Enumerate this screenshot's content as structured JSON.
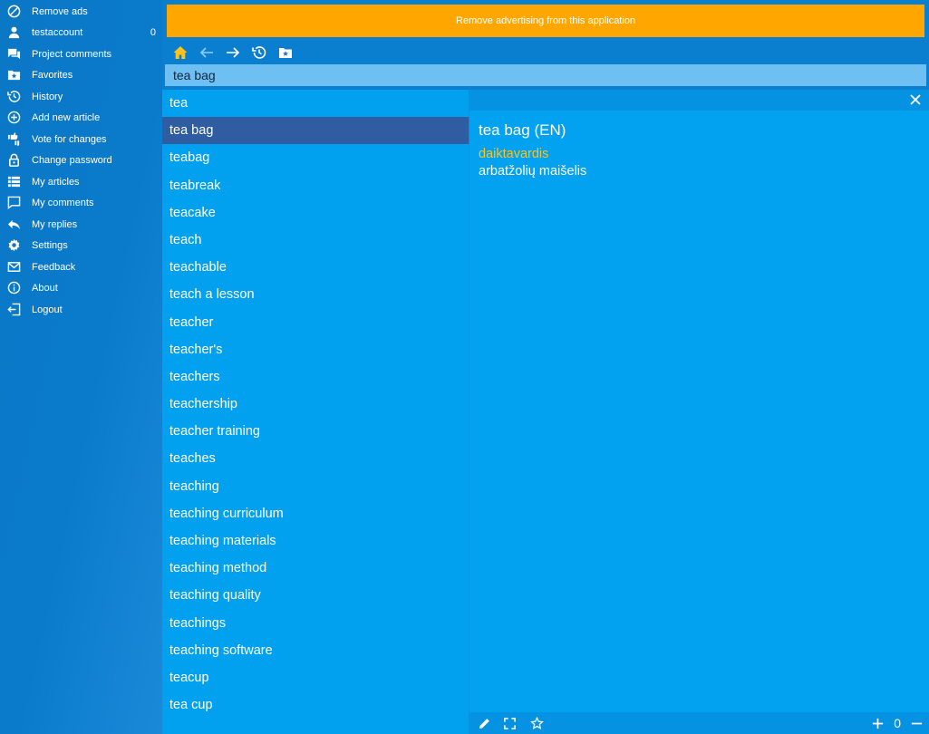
{
  "sidebar": {
    "items": [
      {
        "label": "Remove ads",
        "icon": "block-icon"
      },
      {
        "label": "testaccount",
        "icon": "user-icon",
        "count": "0"
      },
      {
        "label": "Project comments",
        "icon": "forum-icon"
      },
      {
        "label": "Favorites",
        "icon": "folder-star-icon"
      },
      {
        "label": "History",
        "icon": "history-icon"
      },
      {
        "label": "Add new article",
        "icon": "add-circle-icon"
      },
      {
        "label": "Vote for changes",
        "icon": "thumbs-icon"
      },
      {
        "label": "Change password",
        "icon": "lock-icon"
      },
      {
        "label": "My articles",
        "icon": "list-icon"
      },
      {
        "label": "My comments",
        "icon": "comment-icon"
      },
      {
        "label": "My replies",
        "icon": "reply-icon"
      },
      {
        "label": "Settings",
        "icon": "gear-icon"
      },
      {
        "label": "Feedback",
        "icon": "mail-icon"
      },
      {
        "label": "About",
        "icon": "info-icon"
      },
      {
        "label": "Logout",
        "icon": "logout-icon"
      }
    ]
  },
  "ad_banner": {
    "text": "Remove advertising from this application"
  },
  "search": {
    "value": "tea bag"
  },
  "wordlist": {
    "selected_index": 1,
    "words": [
      "tea",
      "tea bag",
      "teabag",
      "teabreak",
      "teacake",
      "teach",
      "teachable",
      "teach a lesson",
      "teacher",
      "teacher's",
      "teachers",
      "teachership",
      "teacher training",
      "teaches",
      "teaching",
      "teaching curriculum",
      "teaching materials",
      "teaching method",
      "teaching quality",
      "teachings",
      "teaching software",
      "teacup",
      "tea cup"
    ]
  },
  "entry": {
    "title": "tea bag (EN)",
    "part_of_speech": "daiktavardis",
    "translation": "arbatžolių maišelis"
  },
  "footer": {
    "vote_count": "0"
  },
  "colors": {
    "accent": "#ffa700",
    "selected": "#305ca2",
    "pos": "#ffc21a",
    "home": "#ffc21a"
  }
}
